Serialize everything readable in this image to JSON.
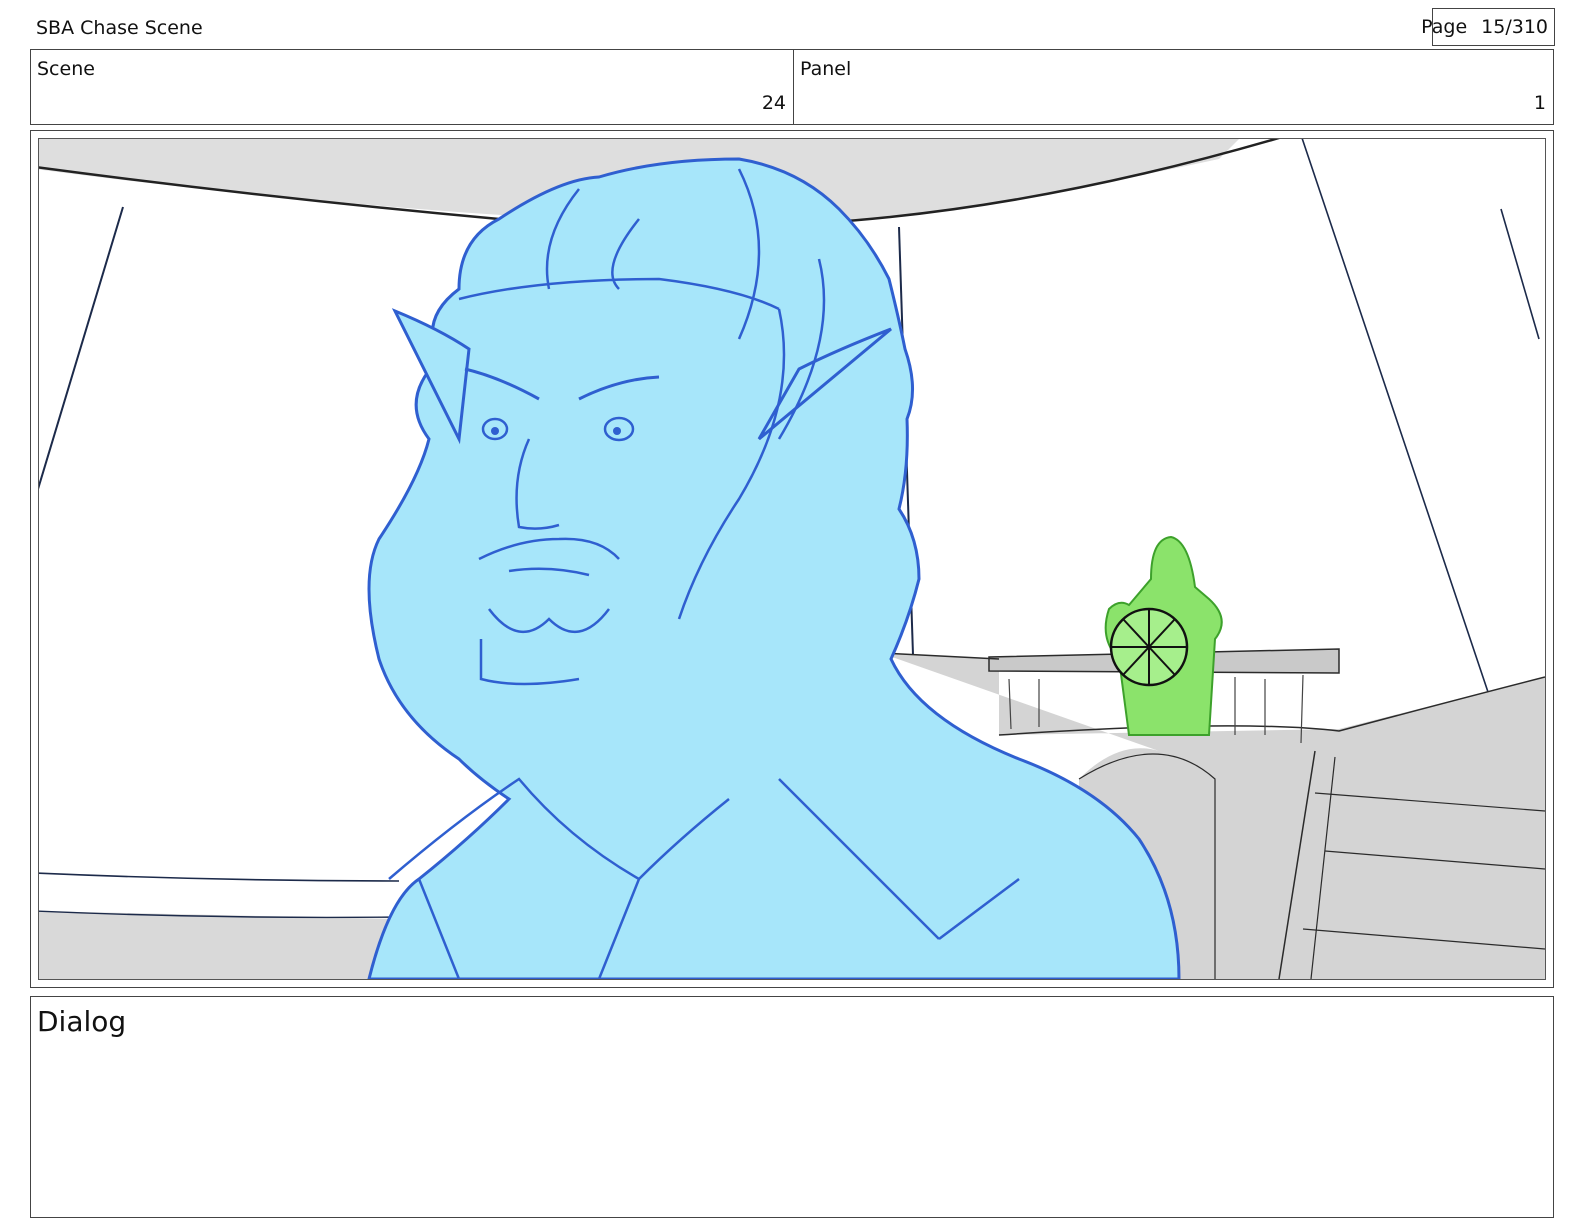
{
  "header": {
    "project_title": "SBA Chase Scene",
    "page_label": "Page",
    "page_number": "15/310"
  },
  "info": {
    "scene_label": "Scene",
    "scene_value": "24",
    "panel_label": "Panel",
    "panel_value": "1"
  },
  "dialog": {
    "label": "Dialog"
  }
}
